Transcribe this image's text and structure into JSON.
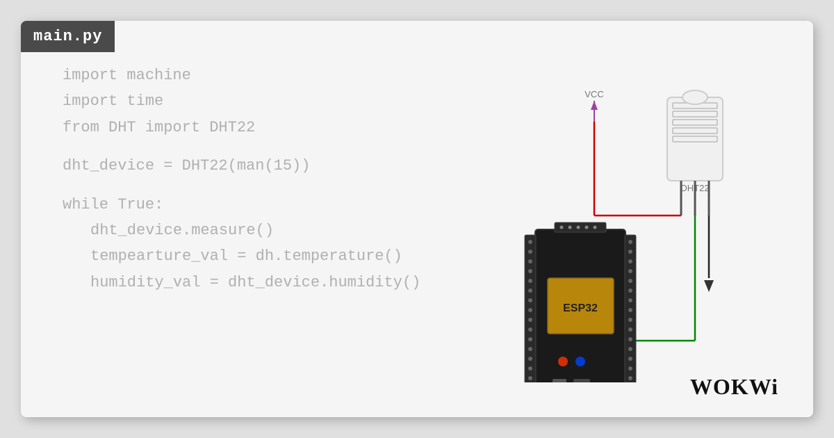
{
  "title": "main.py",
  "code": {
    "lines": [
      {
        "text": "import machine",
        "indent": false,
        "blank": false
      },
      {
        "text": "import time",
        "indent": false,
        "blank": false
      },
      {
        "text": "from DHT import DHT22",
        "indent": false,
        "blank": false
      },
      {
        "text": "",
        "indent": false,
        "blank": true
      },
      {
        "text": "dht_device = DHT22(ma……n(15))",
        "indent": false,
        "blank": false
      },
      {
        "text": "",
        "indent": false,
        "blank": true
      },
      {
        "text": "while True:",
        "indent": false,
        "blank": false
      },
      {
        "text": "dht_device.measure()",
        "indent": true,
        "blank": false
      },
      {
        "text": "tempearture_val = dh…….temperature()",
        "indent": true,
        "blank": false
      },
      {
        "text": "humidity_val = dht_device.humidity()",
        "indent": true,
        "blank": false
      }
    ]
  },
  "logo": {
    "text": "WOKWi",
    "styled": "WOKWi"
  },
  "circuit": {
    "vcc_label": "VCC",
    "dht_label": "DHT22"
  }
}
